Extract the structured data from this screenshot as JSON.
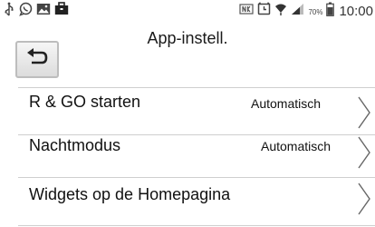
{
  "status_bar": {
    "time": "10:00",
    "battery_percent": "70%",
    "icons_left": [
      "usb-icon",
      "whatsapp-icon",
      "image-icon",
      "briefcase-icon"
    ],
    "icons_right": [
      "nfc-icon",
      "alarm-icon",
      "wifi-icon",
      "signal-icon",
      "battery-icon"
    ]
  },
  "header": {
    "title": "App-instell.",
    "back_icon": "back-arrow-icon"
  },
  "settings": [
    {
      "label": "R & GO starten",
      "value": "Automatisch"
    },
    {
      "label": "Nachtmodus",
      "value": "Automatisch"
    },
    {
      "label": "Widgets op de Homepagina",
      "value": ""
    }
  ],
  "colors": {
    "divider": "#cfcfcf",
    "button_border": "#bdbdbd",
    "text": "#111111"
  }
}
